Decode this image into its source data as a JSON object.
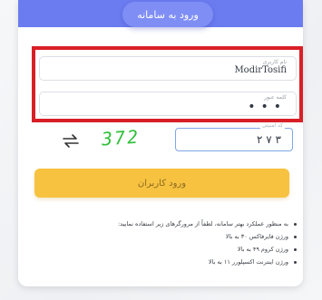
{
  "header": {
    "title": "ورود به سامانه"
  },
  "login_form": {
    "username": {
      "label": "نام کاربری",
      "value": "ModirTosifi"
    },
    "password": {
      "label": "کلمه عبور",
      "value": "•••"
    },
    "captcha": {
      "label": "کد امنیتی",
      "image_text": "372",
      "value": "۳ ۷ ۲"
    },
    "submit_label": "ورود کاربران"
  },
  "notes": [
    "به منظور عملکرد بهتر سامانه، لطفاً از مرورگرهای زیر استفاده نمایید:",
    "ورژن فایرفاکس ۳۰ به بالا",
    "ورژن کروم ۴۹ به بالا",
    "ورژن اینترنت اکسپلورر ۱۱ به بالا"
  ],
  "colors": {
    "header": "#6b7cf0",
    "button": "#f7c240",
    "highlight_border": "#d91f26",
    "captcha_text": "#2fbf3a"
  },
  "icons": {
    "refresh": "refresh-arrows-icon"
  }
}
